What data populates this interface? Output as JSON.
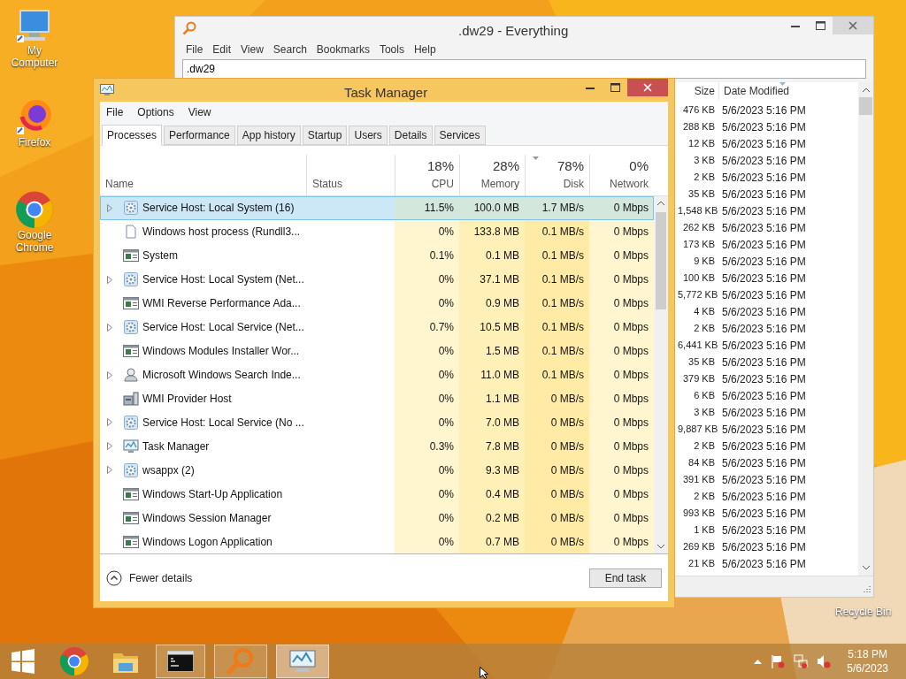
{
  "desktop": {
    "icons": [
      {
        "label": "My Computer",
        "kind": "computer"
      },
      {
        "label": "Firefox",
        "kind": "firefox"
      },
      {
        "label": "Google Chrome",
        "kind": "chrome"
      }
    ],
    "recycle_bin": {
      "label": "Recycle Bin"
    }
  },
  "everything": {
    "title": ".dw29 - Everything",
    "menu": [
      "File",
      "Edit",
      "View",
      "Search",
      "Bookmarks",
      "Tools",
      "Help"
    ],
    "search": {
      "value": ".dw29"
    },
    "columns": [
      {
        "label": "Size",
        "sorted": false
      },
      {
        "label": "Date Modified",
        "sorted": true
      }
    ],
    "rows": [
      {
        "size": "476 KB",
        "date": "5/6/2023 5:16 PM"
      },
      {
        "size": "288 KB",
        "date": "5/6/2023 5:16 PM"
      },
      {
        "size": "12 KB",
        "date": "5/6/2023 5:16 PM"
      },
      {
        "size": "3 KB",
        "date": "5/6/2023 5:16 PM"
      },
      {
        "size": "2 KB",
        "date": "5/6/2023 5:16 PM"
      },
      {
        "size": "35 KB",
        "date": "5/6/2023 5:16 PM"
      },
      {
        "size": "1,548 KB",
        "date": "5/6/2023 5:16 PM"
      },
      {
        "size": "262 KB",
        "date": "5/6/2023 5:16 PM"
      },
      {
        "size": "173 KB",
        "date": "5/6/2023 5:16 PM"
      },
      {
        "size": "9 KB",
        "date": "5/6/2023 5:16 PM"
      },
      {
        "size": "100 KB",
        "date": "5/6/2023 5:16 PM"
      },
      {
        "size": "5,772 KB",
        "date": "5/6/2023 5:16 PM"
      },
      {
        "size": "4 KB",
        "date": "5/6/2023 5:16 PM"
      },
      {
        "size": "2 KB",
        "date": "5/6/2023 5:16 PM"
      },
      {
        "size": "6,441 KB",
        "date": "5/6/2023 5:16 PM"
      },
      {
        "size": "35 KB",
        "date": "5/6/2023 5:16 PM"
      },
      {
        "size": "379 KB",
        "date": "5/6/2023 5:16 PM"
      },
      {
        "size": "6 KB",
        "date": "5/6/2023 5:16 PM"
      },
      {
        "size": "3 KB",
        "date": "5/6/2023 5:16 PM"
      },
      {
        "size": "9,887 KB",
        "date": "5/6/2023 5:16 PM"
      },
      {
        "size": "2 KB",
        "date": "5/6/2023 5:16 PM"
      },
      {
        "size": "84 KB",
        "date": "5/6/2023 5:16 PM"
      },
      {
        "size": "391 KB",
        "date": "5/6/2023 5:16 PM"
      },
      {
        "size": "2 KB",
        "date": "5/6/2023 5:16 PM"
      },
      {
        "size": "993 KB",
        "date": "5/6/2023 5:16 PM"
      },
      {
        "size": "1 KB",
        "date": "5/6/2023 5:16 PM"
      },
      {
        "size": "269 KB",
        "date": "5/6/2023 5:16 PM"
      },
      {
        "size": "21 KB",
        "date": "5/6/2023 5:16 PM"
      }
    ]
  },
  "task_manager": {
    "title": "Task Manager",
    "menu": [
      "File",
      "Options",
      "View"
    ],
    "tabs": [
      {
        "label": "Processes",
        "selected": true
      },
      {
        "label": "Performance",
        "selected": false
      },
      {
        "label": "App history",
        "selected": false
      },
      {
        "label": "Startup",
        "selected": false
      },
      {
        "label": "Users",
        "selected": false
      },
      {
        "label": "Details",
        "selected": false
      },
      {
        "label": "Services",
        "selected": false
      }
    ],
    "columns": [
      {
        "label": "Name",
        "kind": "name"
      },
      {
        "label": "Status",
        "kind": "status"
      },
      {
        "label": "CPU",
        "kind": "metric",
        "usage": "18%",
        "sorted": false
      },
      {
        "label": "Memory",
        "kind": "metric",
        "usage": "28%",
        "sorted": false
      },
      {
        "label": "Disk",
        "kind": "metric",
        "usage": "78%",
        "sorted": true
      },
      {
        "label": "Network",
        "kind": "metric",
        "usage": "0%",
        "sorted": false
      }
    ],
    "rows": [
      {
        "name": "Service Host: Local System (16)",
        "kind": "gear",
        "expandable": true,
        "selected": true,
        "cpu": "11.5%",
        "memory": "100.0 MB",
        "disk": "1.7 MB/s",
        "network": "0 Mbps"
      },
      {
        "name": "Windows host process (Rundll3...",
        "kind": "document",
        "expandable": false,
        "selected": false,
        "cpu": "0%",
        "memory": "133.8 MB",
        "disk": "0.1 MB/s",
        "network": "0 Mbps"
      },
      {
        "name": "System",
        "kind": "window",
        "expandable": false,
        "selected": false,
        "cpu": "0.1%",
        "memory": "0.1 MB",
        "disk": "0.1 MB/s",
        "network": "0 Mbps"
      },
      {
        "name": "Service Host: Local System (Net...",
        "kind": "gear",
        "expandable": true,
        "selected": false,
        "cpu": "0%",
        "memory": "37.1 MB",
        "disk": "0.1 MB/s",
        "network": "0 Mbps"
      },
      {
        "name": "WMI Reverse Performance Ada...",
        "kind": "window",
        "expandable": false,
        "selected": false,
        "cpu": "0%",
        "memory": "0.9 MB",
        "disk": "0.1 MB/s",
        "network": "0 Mbps"
      },
      {
        "name": "Service Host: Local Service (Net...",
        "kind": "gear",
        "expandable": true,
        "selected": false,
        "cpu": "0.7%",
        "memory": "10.5 MB",
        "disk": "0.1 MB/s",
        "network": "0 Mbps"
      },
      {
        "name": "Windows Modules Installer Wor...",
        "kind": "window",
        "expandable": false,
        "selected": false,
        "cpu": "0%",
        "memory": "1.5 MB",
        "disk": "0.1 MB/s",
        "network": "0 Mbps"
      },
      {
        "name": "Microsoft Windows Search Inde...",
        "kind": "person",
        "expandable": true,
        "selected": false,
        "cpu": "0%",
        "memory": "11.0 MB",
        "disk": "0.1 MB/s",
        "network": "0 Mbps"
      },
      {
        "name": "WMI Provider Host",
        "kind": "server",
        "expandable": false,
        "selected": false,
        "cpu": "0%",
        "memory": "1.1 MB",
        "disk": "0 MB/s",
        "network": "0 Mbps"
      },
      {
        "name": "Service Host: Local Service (No ...",
        "kind": "gear",
        "expandable": true,
        "selected": false,
        "cpu": "0%",
        "memory": "7.0 MB",
        "disk": "0 MB/s",
        "network": "0 Mbps"
      },
      {
        "name": "Task Manager",
        "kind": "monitor",
        "expandable": true,
        "selected": false,
        "cpu": "0.3%",
        "memory": "7.8 MB",
        "disk": "0 MB/s",
        "network": "0 Mbps"
      },
      {
        "name": "wsappx (2)",
        "kind": "gear",
        "expandable": true,
        "selected": false,
        "cpu": "0%",
        "memory": "9.3 MB",
        "disk": "0 MB/s",
        "network": "0 Mbps"
      },
      {
        "name": "Windows Start-Up Application",
        "kind": "window",
        "expandable": false,
        "selected": false,
        "cpu": "0%",
        "memory": "0.4 MB",
        "disk": "0 MB/s",
        "network": "0 Mbps"
      },
      {
        "name": "Windows Session Manager",
        "kind": "window",
        "expandable": false,
        "selected": false,
        "cpu": "0%",
        "memory": "0.2 MB",
        "disk": "0 MB/s",
        "network": "0 Mbps"
      },
      {
        "name": "Windows Logon Application",
        "kind": "window",
        "expandable": false,
        "selected": false,
        "cpu": "0%",
        "memory": "0.7 MB",
        "disk": "0 MB/s",
        "network": "0 Mbps"
      }
    ],
    "fewer_details": "Fewer details",
    "end_task": "End task"
  },
  "taskbar": {
    "items": [
      {
        "kind": "start",
        "running": false,
        "selected": false
      },
      {
        "kind": "chrome",
        "running": false,
        "selected": false
      },
      {
        "kind": "folder",
        "running": false,
        "selected": false
      },
      {
        "kind": "terminal",
        "running": true,
        "selected": false
      },
      {
        "kind": "search",
        "running": true,
        "selected": false
      },
      {
        "kind": "monitor",
        "running": true,
        "selected": true
      }
    ],
    "clock": {
      "time": "5:18 PM",
      "date": "5/6/2023"
    }
  }
}
